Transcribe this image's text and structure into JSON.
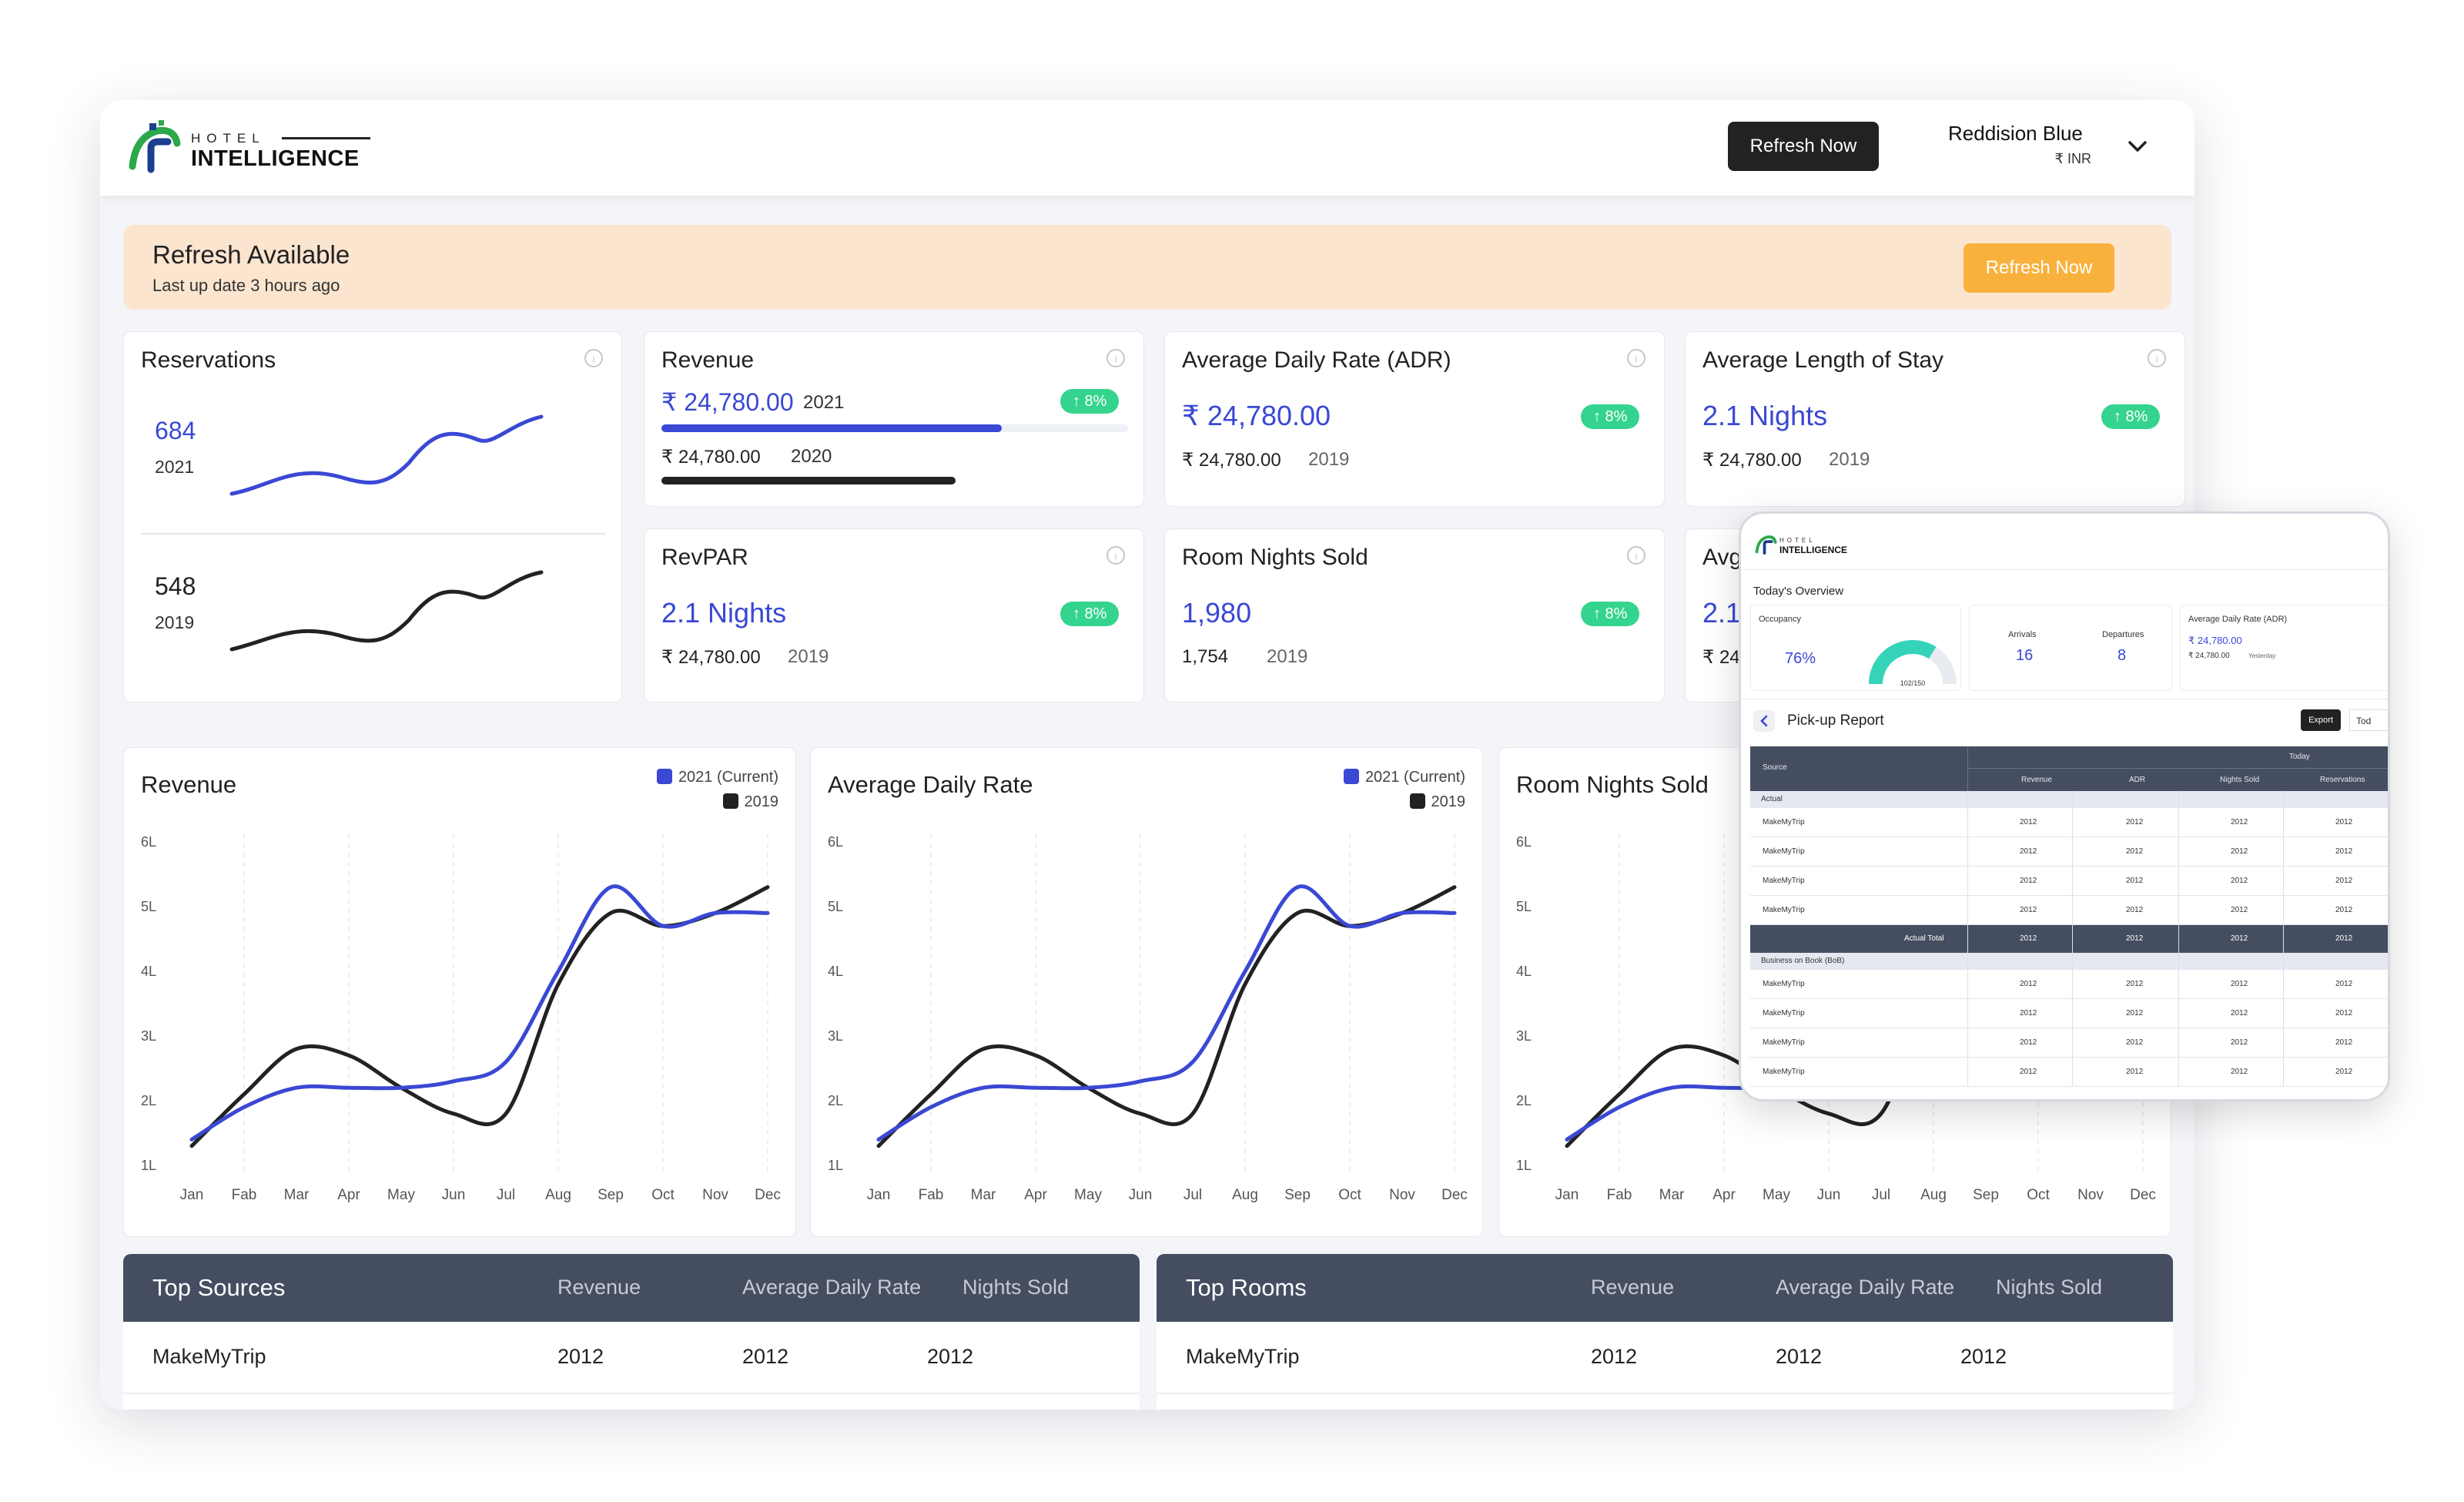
{
  "app": {
    "logo_top": "HOTEL",
    "logo_main": "INTELLIGENCE",
    "refresh_button": "Refresh Now",
    "hotel_name": "Reddision Blue",
    "currency": "₹ INR"
  },
  "banner": {
    "title": "Refresh Available",
    "subtitle": "Last up date 3 hours ago",
    "button": "Refresh Now"
  },
  "kpis": {
    "reservations": {
      "title": "Reservations",
      "current": "684",
      "current_year": "2021",
      "previous": "548",
      "previous_year": "2019"
    },
    "revenue": {
      "title": "Revenue",
      "value": "₹ 24,780.00",
      "year": "2021",
      "compare_value": "₹ 24,780.00",
      "compare_year": "2020",
      "badge": "↑ 8%",
      "current_fill": 0.73,
      "compare_fill": 0.63
    },
    "adr": {
      "title": "Average Daily Rate (ADR)",
      "value": "₹ 24,780.00",
      "compare_value": "₹ 24,780.00",
      "compare_year": "2019",
      "badge": "↑ 8%"
    },
    "alos": {
      "title": "Average Length of Stay",
      "value": "2.1 Nights",
      "compare_value": "₹ 24,780.00",
      "compare_year": "2019",
      "badge": "↑ 8%"
    },
    "revpar": {
      "title": "RevPAR",
      "value": "2.1 Nights",
      "compare_value": "₹ 24,780.00",
      "compare_year": "2019",
      "badge": "↑ 8%"
    },
    "room_nights": {
      "title": "Room Nights Sold",
      "value": "1,980",
      "compare_value": "1,754",
      "compare_year": "2019",
      "badge": "↑ 8%"
    },
    "partial": {
      "title": "Avg",
      "value": "2.1",
      "compare_value": "₹ 24"
    }
  },
  "colors": {
    "current": "#3a48d4",
    "previous": "#222222",
    "badge": "#35d48e",
    "accent_orange": "#f9b13d",
    "header_dark": "#454e60"
  },
  "chart_data": [
    {
      "type": "line",
      "title": "Revenue",
      "categories": [
        "Jan",
        "Fab",
        "Mar",
        "Apr",
        "May",
        "Jun",
        "Jul",
        "Aug",
        "Sep",
        "Oct",
        "Nov",
        "Dec"
      ],
      "y_ticks": [
        "6L",
        "5L",
        "4L",
        "3L",
        "2L",
        "1L"
      ],
      "ylim": [
        1,
        6
      ],
      "legend": [
        "2021 (Current)",
        "2019"
      ],
      "legend_position": "top-right",
      "series": [
        {
          "name": "2021 (Current)",
          "color": "#3a48d4",
          "values": [
            1.4,
            1.9,
            2.2,
            2.2,
            2.2,
            2.3,
            2.6,
            4.0,
            5.3,
            4.7,
            4.9,
            4.9
          ]
        },
        {
          "name": "2019",
          "color": "#222222",
          "values": [
            1.3,
            2.1,
            2.8,
            2.7,
            2.2,
            1.8,
            1.8,
            3.8,
            4.9,
            4.7,
            4.9,
            5.3
          ]
        }
      ]
    },
    {
      "type": "line",
      "title": "Average Daily Rate",
      "categories": [
        "Jan",
        "Fab",
        "Mar",
        "Apr",
        "May",
        "Jun",
        "Jul",
        "Aug",
        "Sep",
        "Oct",
        "Nov",
        "Dec"
      ],
      "y_ticks": [
        "6L",
        "5L",
        "4L",
        "3L",
        "2L",
        "1L"
      ],
      "ylim": [
        1,
        6
      ],
      "legend": [
        "2021 (Current)",
        "2019"
      ],
      "legend_position": "top-right",
      "series": [
        {
          "name": "2021 (Current)",
          "color": "#3a48d4",
          "values": [
            1.4,
            1.9,
            2.2,
            2.2,
            2.2,
            2.3,
            2.6,
            4.0,
            5.3,
            4.7,
            4.9,
            4.9
          ]
        },
        {
          "name": "2019",
          "color": "#222222",
          "values": [
            1.3,
            2.1,
            2.8,
            2.7,
            2.2,
            1.8,
            1.8,
            3.8,
            4.9,
            4.7,
            4.9,
            5.3
          ]
        }
      ]
    },
    {
      "type": "line",
      "title": "Room Nights Sold",
      "categories": [
        "Jan",
        "Fab",
        "Mar",
        "Apr",
        "May",
        "Jun",
        "Jul",
        "Aug",
        "Sep",
        "Oct",
        "Nov",
        "Dec"
      ],
      "y_ticks": [
        "6L",
        "5L",
        "4L",
        "3L",
        "2L",
        "1L"
      ],
      "ylim": [
        1,
        6
      ],
      "series": [
        {
          "name": "2021 (Current)",
          "color": "#3a48d4",
          "values": [
            1.4,
            1.9,
            2.2,
            2.2,
            2.2,
            2.3,
            2.6,
            4.0,
            5.3,
            4.7,
            4.9,
            4.9
          ]
        },
        {
          "name": "2019",
          "color": "#222222",
          "values": [
            1.3,
            2.1,
            2.8,
            2.7,
            2.2,
            1.8,
            1.8,
            3.8,
            4.9,
            4.7,
            4.9,
            5.3
          ]
        }
      ]
    }
  ],
  "top_sources": {
    "title": "Top Sources",
    "columns": [
      "Revenue",
      "Average Daily Rate",
      "Nights Sold"
    ],
    "rows": [
      [
        "MakeMyTrip",
        "2012",
        "2012",
        "2012"
      ]
    ]
  },
  "top_rooms": {
    "title": "Top Rooms",
    "columns": [
      "Revenue",
      "Average Daily Rate",
      "Nights Sold"
    ],
    "rows": [
      [
        "MakeMyTrip",
        "2012",
        "2012",
        "2012"
      ]
    ]
  },
  "tablet": {
    "logo_top": "HOTEL",
    "logo_main": "INTELLIGENCE",
    "overview_title": "Today's Overview",
    "occupancy": {
      "label": "Occupancy",
      "value": "76%",
      "gauge_label": "102/150",
      "fraction": 0.68
    },
    "arrivals": {
      "label": "Arrivals",
      "value": "16"
    },
    "departures": {
      "label": "Departures",
      "value": "8"
    },
    "adr": {
      "label": "Average Daily Rate (ADR)",
      "value": "₹ 24,780.00",
      "compare": "₹ 24,780.00",
      "compare_label": "Yesterday"
    },
    "report_title": "Pick-up Report",
    "export": "Export",
    "today_tab": "Tod",
    "table": {
      "source_header": "Source",
      "group_header": "Today",
      "columns": [
        "Revenue",
        "ADR",
        "Nights Sold",
        "Reservations"
      ],
      "section1": "Actual",
      "section1_rows": [
        [
          "MakeMyTrip",
          "2012",
          "2012",
          "2012",
          "2012"
        ],
        [
          "MakeMyTrip",
          "2012",
          "2012",
          "2012",
          "2012"
        ],
        [
          "MakeMyTrip",
          "2012",
          "2012",
          "2012",
          "2012"
        ],
        [
          "MakeMyTrip",
          "2012",
          "2012",
          "2012",
          "2012"
        ]
      ],
      "total": [
        "Actual Total",
        "2012",
        "2012",
        "2012",
        "2012"
      ],
      "section2": "Business on Book (BoB)",
      "section2_rows": [
        [
          "MakeMyTrip",
          "2012",
          "2012",
          "2012",
          "2012"
        ],
        [
          "MakeMyTrip",
          "2012",
          "2012",
          "2012",
          "2012"
        ],
        [
          "MakeMyTrip",
          "2012",
          "2012",
          "2012",
          "2012"
        ],
        [
          "MakeMyTrip",
          "2012",
          "2012",
          "2012",
          "2012"
        ]
      ]
    }
  }
}
